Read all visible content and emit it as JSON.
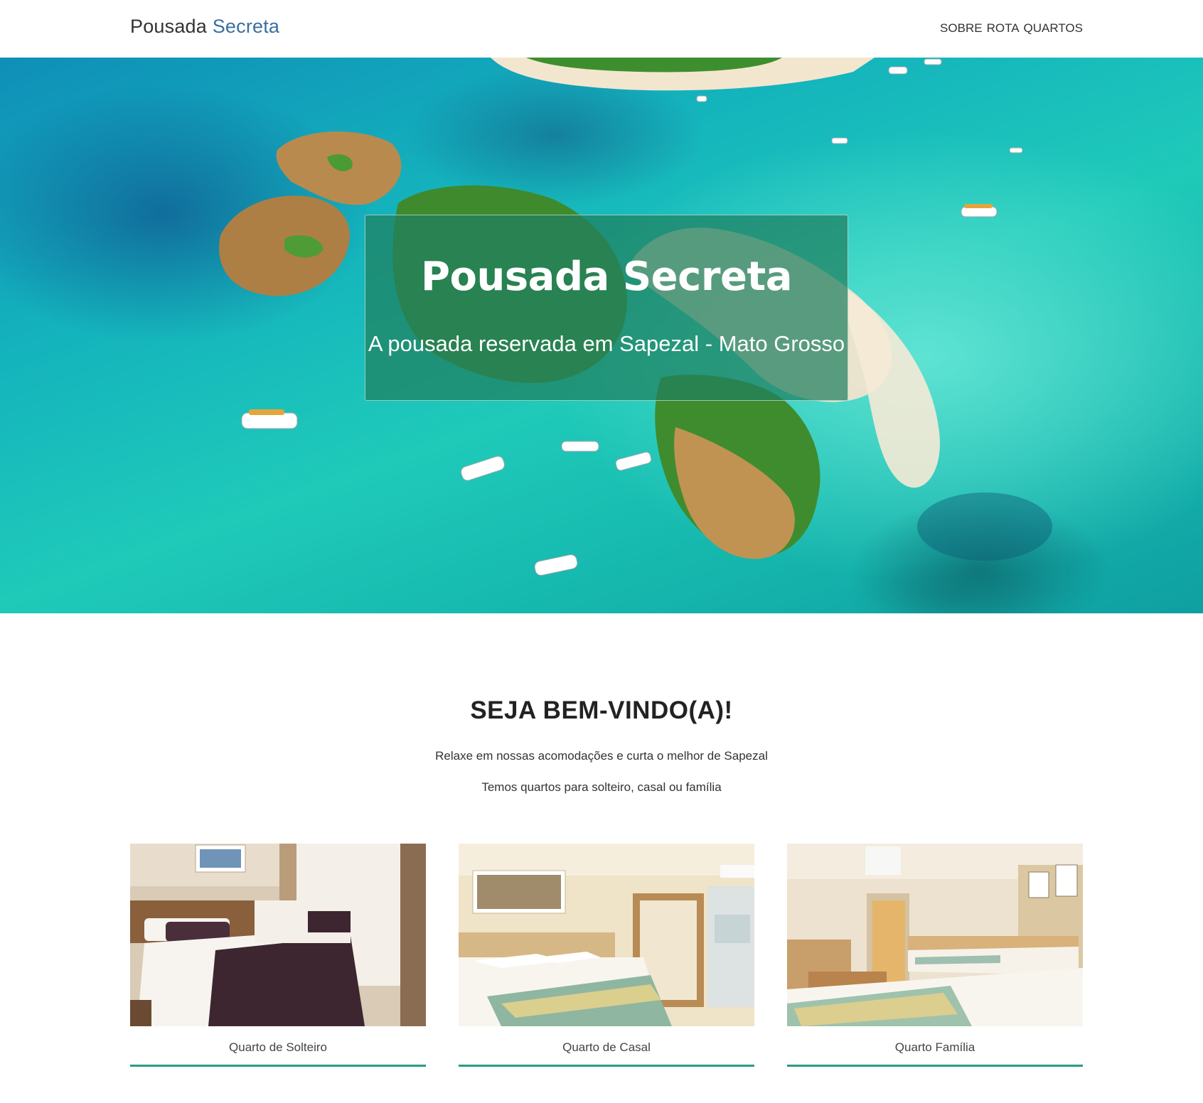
{
  "navbar": {
    "brand_main": "Pousada",
    "brand_accent": "Secreta",
    "links": [
      "SOBRE",
      "ROTA",
      "QUARTOS"
    ]
  },
  "hero": {
    "title": "Pousada Secreta",
    "subtitle": "A pousada reservada em Sapezal - Mato Grosso"
  },
  "welcome": {
    "title": "SEJA BEM-VINDO(A)!",
    "line1": "Relaxe em nossas acomodações e curta o melhor de Sapezal",
    "line2": "Temos quartos para solteiro, casal ou família"
  },
  "rooms": [
    {
      "caption": "Quarto de Solteiro"
    },
    {
      "caption": "Quarto de Casal"
    },
    {
      "caption": "Quarto Família"
    }
  ],
  "colors": {
    "brand_accent": "#3a6fa0",
    "hero_box": "#208060",
    "card_rule": "#2a9a86"
  }
}
